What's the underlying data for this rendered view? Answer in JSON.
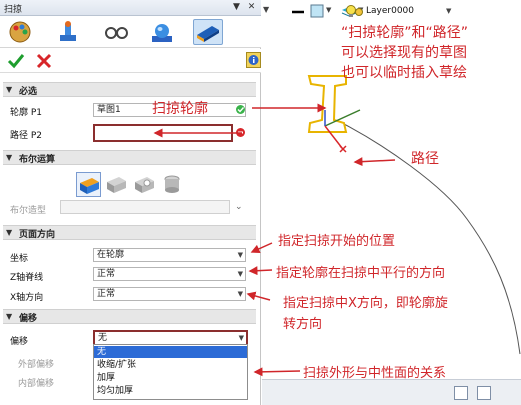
{
  "panel": {
    "title": "扫掠",
    "pin": "▼",
    "close": "✕"
  },
  "sections": {
    "required": "必选",
    "boolean": "布尔运算",
    "direction": "页面方向",
    "offset": "偏移"
  },
  "required": {
    "profile_label": "轮廓 P1",
    "profile_value": "草图1",
    "path_label": "路径 P2",
    "path_value": ""
  },
  "boolean": {
    "shape_label": "布尔造型"
  },
  "direction": {
    "coord_label": "坐标",
    "coord_value": "在轮廓",
    "z_label": "Z轴脊线",
    "z_value": "正常",
    "x_label": "X轴方向",
    "x_value": "正常"
  },
  "offset": {
    "offset_label": "偏移",
    "offset_value": "无",
    "outer_label": "外部偏移",
    "inner_label": "内部偏移",
    "options": [
      "无",
      "收缩/扩张",
      "加厚",
      "均匀加厚"
    ],
    "selected_index": 0
  },
  "workspace": {
    "layer_name": "Layer0000"
  },
  "annotations": {
    "top_line1": "“扫掠轮廓”和“路径”",
    "top_line2": "可以选择现有的草图",
    "top_line3": "也可以临时插入草绘",
    "profile": "扫掠轮廓",
    "path": "路径",
    "start": "指定扫掠开始的位置",
    "parallel": "指定轮廓在扫掠中平行的方向",
    "xdir1": "指定扫掠中X方向，即轮廓旋",
    "xdir2": "转方向",
    "offset": "扫掠外形与中性面的关系"
  },
  "colors": {
    "annotation": "#d0262a",
    "path_field_border": "#8b2e2e",
    "selected_option": "#2c6bd6",
    "sketch_yellow": "#e8b400"
  }
}
